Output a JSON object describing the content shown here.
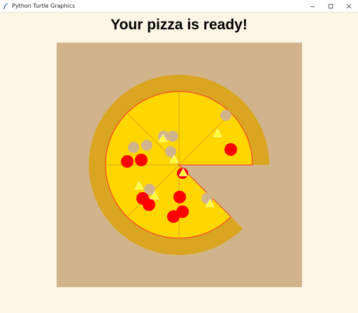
{
  "window": {
    "title": "Python Turtle Graphics",
    "icon": "feather-icon",
    "controls": [
      "minimize-icon",
      "maximize-icon",
      "close-icon"
    ]
  },
  "canvas": {
    "heading": "Your pizza is ready!"
  },
  "colors": {
    "background": "#fdf5e6",
    "board": "#d2b48c",
    "crust": "#daa520",
    "cheese": "#ffd700",
    "sauce_line": "#ff3030",
    "pepperoni": "#ff0000",
    "mushroom": "#d2b48c",
    "pepper": "#ffff33"
  },
  "pizza": {
    "slices_total": 8,
    "slices_remaining": 7
  }
}
